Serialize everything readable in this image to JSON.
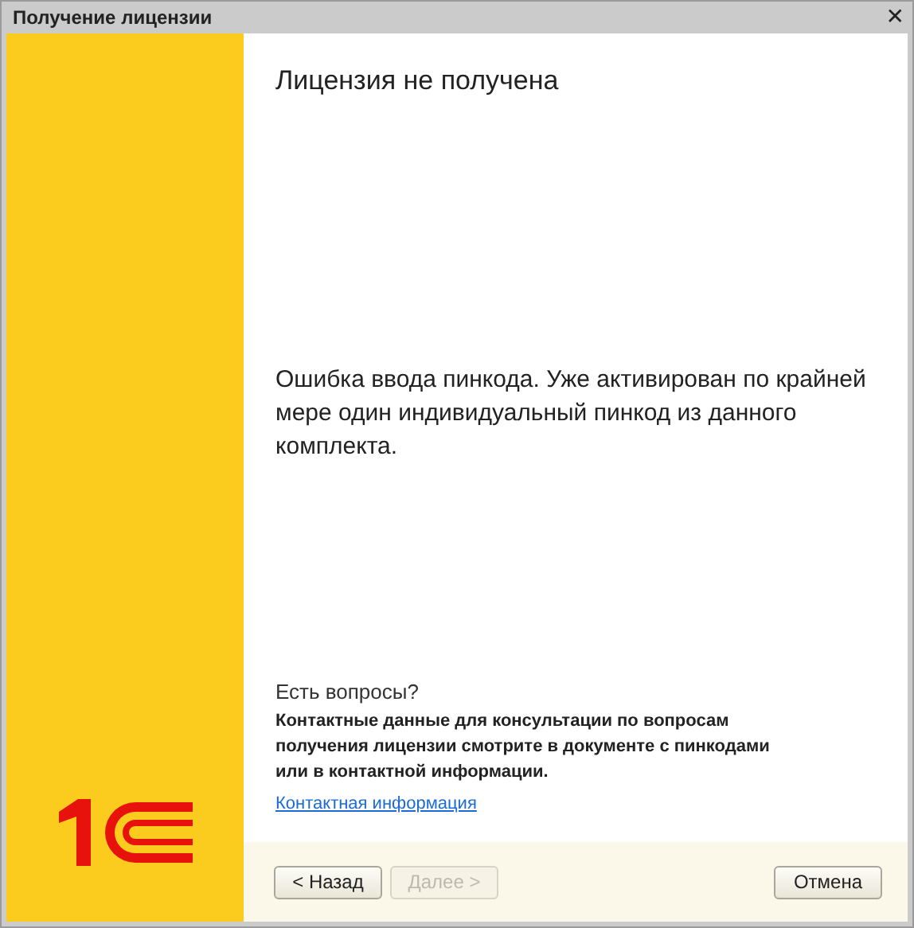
{
  "window": {
    "title": "Получение лицензии",
    "close": "✕"
  },
  "heading": "Лицензия не получена",
  "message": "Ошибка ввода пинкода. Уже активирован по крайней мере один индивидуальный пинкод из данного комплекта.",
  "help": {
    "question": "Есть вопросы?",
    "text": "Контактные данные для консультации по вопросам получения лицензии смотрите в документе с пинкодами или в контактной информации.",
    "link": "Контактная информация"
  },
  "buttons": [
    {
      "label": "< Назад",
      "disabled": false,
      "kind": "left"
    },
    {
      "label": "Далее >",
      "disabled": true,
      "kind": "left"
    },
    {
      "label": "Отмена",
      "disabled": false,
      "kind": "right"
    }
  ]
}
